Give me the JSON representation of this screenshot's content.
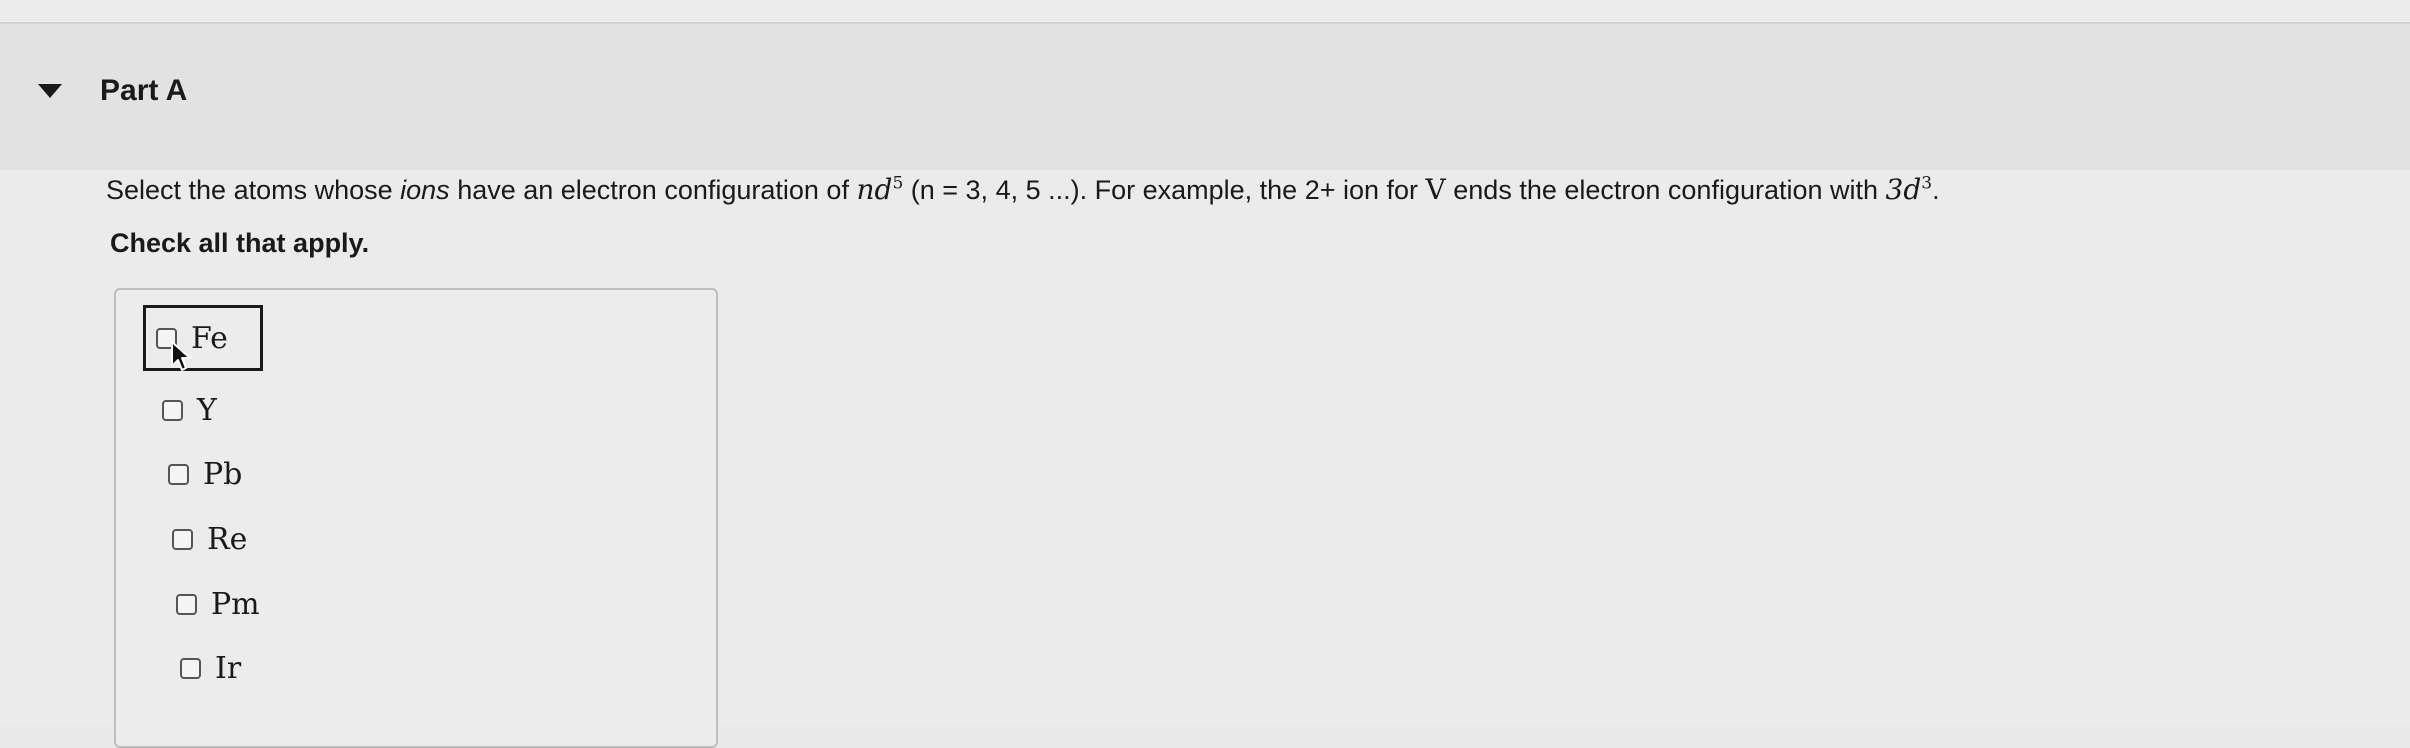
{
  "part": {
    "title": "Part A"
  },
  "question": {
    "text_before_ions": "Select the atoms whose ",
    "ions_word": "ions",
    "text_after_ions": " have an electron configuration of ",
    "config_base": "nd",
    "config_sup": "5",
    "text_n_values": " (n = 3, 4, 5 ...). For example, the 2+ ion for ",
    "element": "V",
    "text_ends": " ends the electron configuration with ",
    "example_base": "3d",
    "example_sup": "3",
    "trailing": "."
  },
  "instruction": "Check all that apply.",
  "choices": [
    {
      "label": "Fe",
      "checked": false
    },
    {
      "label": "Y",
      "checked": false
    },
    {
      "label": "Pb",
      "checked": false
    },
    {
      "label": "Re",
      "checked": false
    },
    {
      "label": "Pm",
      "checked": false
    },
    {
      "label": "Ir",
      "checked": false
    }
  ],
  "icons": {
    "collapse": "caret-down-icon",
    "pointer": "mouse-cursor-icon"
  }
}
